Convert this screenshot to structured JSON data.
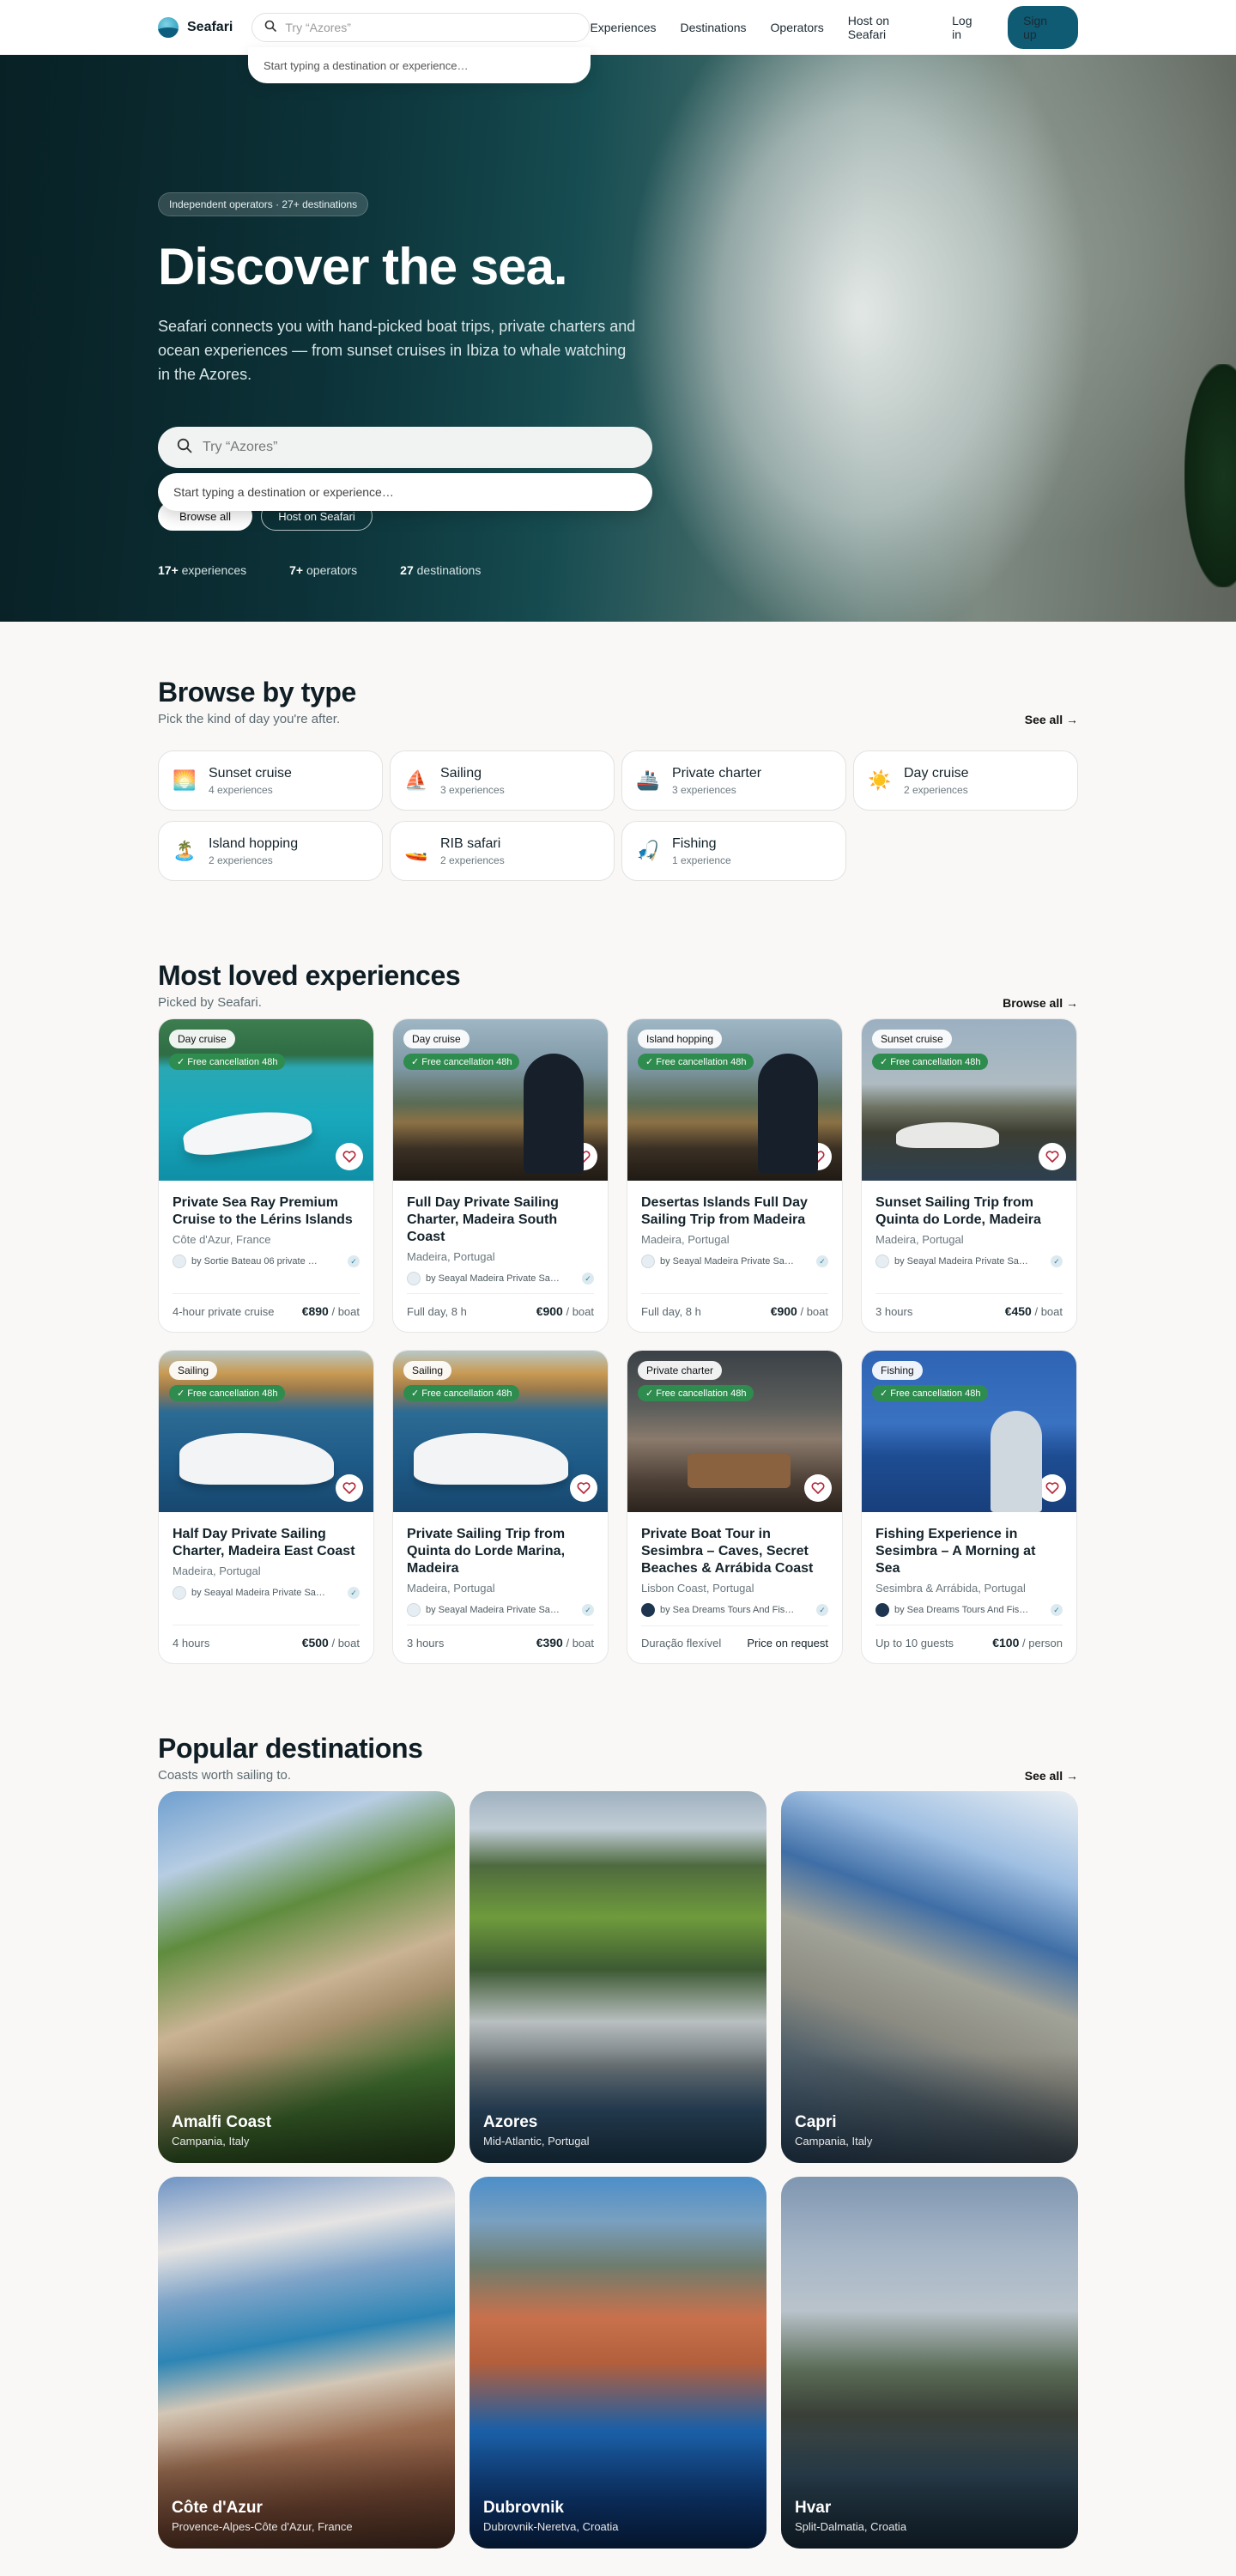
{
  "nav": {
    "logo": "Seafari",
    "search_placeholder": "Try “Azores”",
    "dropdown_hint": "Start typing a destination or experience…",
    "links": [
      "Experiences",
      "Destinations",
      "Operators",
      "Host on Seafari",
      "Log in"
    ],
    "signup": "Sign up"
  },
  "hero": {
    "badge": "Independent operators · 27+ destinations",
    "title": "Discover the sea.",
    "subtitle": "Seafari connects you with hand-picked boat trips, private charters and ocean experiences — from sunset cruises in Ibiza to whale watching in the Azores.",
    "search_placeholder": "Try “Azores”",
    "dropdown_hint": "Start typing a destination or experience…",
    "btn_browse": "Browse all",
    "btn_host": "Host on Seafari",
    "stats": [
      {
        "value": "17+",
        "label": "experiences"
      },
      {
        "value": "7+",
        "label": "operators"
      },
      {
        "value": "27",
        "label": "destinations"
      }
    ]
  },
  "types": {
    "title": "Browse by type",
    "subtitle": "Pick the kind of day you're after.",
    "see_all": "See all →",
    "items": [
      {
        "emoji": "🌅",
        "icon": "sunset-icon",
        "name": "Sunset cruise",
        "count": "4 experiences"
      },
      {
        "emoji": "⛵",
        "icon": "sailboat-icon",
        "name": "Sailing",
        "count": "3 experiences"
      },
      {
        "emoji": "🚢",
        "icon": "ship-icon",
        "name": "Private charter",
        "count": "3 experiences"
      },
      {
        "emoji": "☀️",
        "icon": "sun-icon",
        "name": "Day cruise",
        "count": "2 experiences"
      },
      {
        "emoji": "🏝️",
        "icon": "island-icon",
        "name": "Island hopping",
        "count": "2 experiences"
      },
      {
        "emoji": "🚤",
        "icon": "speedboat-icon",
        "name": "RIB safari",
        "count": "2 experiences"
      },
      {
        "emoji": "🎣",
        "icon": "fishing-icon",
        "name": "Fishing",
        "count": "1 experience"
      }
    ]
  },
  "experiences": {
    "title": "Most loved experiences",
    "subtitle": "Picked by Seafari.",
    "browse_all": "Browse all →",
    "free_cancel": "✓ Free cancellation 48h",
    "items": [
      {
        "tag": "Day cruise",
        "title": "Private Sea Ray Premium Cruise to the Lérins Islands",
        "location": "Côte d'Azur, France",
        "operator": "by Sortie Bateau 06 private …",
        "duration": "4-hour private cruise",
        "price": "€890",
        "unit": "/ boat"
      },
      {
        "tag": "Day cruise",
        "title": "Full Day Private Sailing Charter, Madeira South Coast",
        "location": "Madeira, Portugal",
        "operator": "by Seayal Madeira Private Sa…",
        "duration": "Full day, 8 h",
        "price": "€900",
        "unit": "/ boat"
      },
      {
        "tag": "Island hopping",
        "title": "Desertas Islands Full Day Sailing Trip from Madeira",
        "location": "Madeira, Portugal",
        "operator": "by Seayal Madeira Private Sa…",
        "duration": "Full day, 8 h",
        "price": "€900",
        "unit": "/ boat"
      },
      {
        "tag": "Sunset cruise",
        "title": "Sunset Sailing Trip from Quinta do Lorde, Madeira",
        "location": "Madeira, Portugal",
        "operator": "by Seayal Madeira Private Sa…",
        "duration": "3 hours",
        "price": "€450",
        "unit": "/ boat"
      },
      {
        "tag": "Sailing",
        "title": "Half Day Private Sailing Charter, Madeira East Coast",
        "location": "Madeira, Portugal",
        "operator": "by Seayal Madeira Private Sa…",
        "duration": "4 hours",
        "price": "€500",
        "unit": "/ boat"
      },
      {
        "tag": "Sailing",
        "title": "Private Sailing Trip from Quinta do Lorde Marina, Madeira",
        "location": "Madeira, Portugal",
        "operator": "by Seayal Madeira Private Sa…",
        "duration": "3 hours",
        "price": "€390",
        "unit": "/ boat"
      },
      {
        "tag": "Private charter",
        "title": "Private Boat Tour in Sesimbra – Caves, Secret Beaches & Arrábida Coast",
        "location": "Lisbon Coast, Portugal",
        "operator": "by Sea Dreams Tours And Fis…",
        "duration": "Duração flexível",
        "price": "Price on request",
        "unit": ""
      },
      {
        "tag": "Fishing",
        "title": "Fishing Experience in Sesimbra – A Morning at Sea",
        "location": "Sesimbra & Arrábida, Portugal",
        "operator": "by Sea Dreams Tours And Fis…",
        "duration": "Up to 10 guests",
        "price": "€100",
        "unit": "/ person"
      }
    ]
  },
  "destinations": {
    "title": "Popular destinations",
    "subtitle": "Coasts worth sailing to.",
    "see_all": "See all →",
    "items": [
      {
        "name": "Amalfi Coast",
        "region": "Campania, Italy"
      },
      {
        "name": "Azores",
        "region": "Mid-Atlantic, Portugal"
      },
      {
        "name": "Capri",
        "region": "Campania, Italy"
      },
      {
        "name": "Côte d'Azur",
        "region": "Provence-Alpes-Côte d'Azur, France"
      },
      {
        "name": "Dubrovnik",
        "region": "Dubrovnik-Neretva, Croatia"
      },
      {
        "name": "Hvar",
        "region": "Split-Dalmatia, Croatia"
      }
    ]
  },
  "colors": {
    "brand": "#0e5b73",
    "free_badge": "#2f8c4f",
    "background": "#f9f8f6"
  }
}
